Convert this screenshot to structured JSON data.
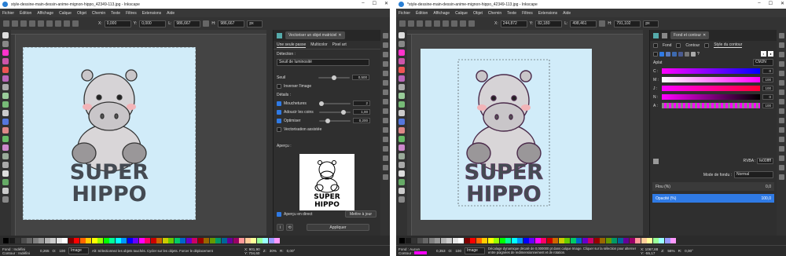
{
  "app": {
    "title": "style-dessine-main-dessin-anime-mignon-hippo_42349-113.jpg - Inkscape",
    "title2": "*style-dessine-main-dessin-anime-mignon-hippo_42349-113.jpg - Inkscape"
  },
  "menu": [
    "Fichier",
    "Édition",
    "Affichage",
    "Calque",
    "Objet",
    "Chemin",
    "Texte",
    "Filtres",
    "Extensions",
    "Aide"
  ],
  "w1": {
    "ctrl": {
      "x_label": "X:",
      "x": "0,000",
      "y_label": "Y:",
      "y": "0,000",
      "w_label": "L:",
      "w": "986,667",
      "h_label": "H:",
      "h": "986,667",
      "unit": "px"
    },
    "panel": {
      "title": "Vectoriser un objet matriciel",
      "tabs": [
        "Une seule passe",
        "Multicolor",
        "Pixel art"
      ],
      "detection": "Détection :",
      "mode": "Seuil de luminosité",
      "seuil": "Seuil",
      "seuil_val": "0,500",
      "inverser": "Inverser l'image",
      "details": "Détails :",
      "mouch": "Mouchetures",
      "mouch_val": "2",
      "adoucir": "Adoucir les coins",
      "adoucir_val": "1,00",
      "optim": "Optimiser",
      "optim_val": "0,200",
      "assist": "Vectorisation assistée",
      "apercu": "Aperçu :",
      "live": "Aperçu en direct",
      "update": "Mettre à jour",
      "apply": "Appliquer"
    },
    "status": {
      "fond": "Fond :",
      "contour": "Contour :",
      "fond_val": "Indéfini",
      "contour_val": "Indéfini",
      "contour_w": "0,265",
      "o": "O:",
      "opacity": "100",
      "layer": "Image",
      "msg": "Alt: Sélectionnez les objets touchés. Cycler sur les objets. Forcer le déplacement",
      "x": "X: 901,90",
      "y": "Y: 704,60",
      "z": "Z:",
      "zoom": "30%",
      "r": "R:",
      "rot": "0,00°"
    }
  },
  "w2": {
    "ctrl": {
      "x_label": "X:",
      "x": "244,872",
      "y_label": "Y:",
      "y": "82,180",
      "w_label": "L:",
      "w": "498,461",
      "h_label": "H:",
      "h": "791,102",
      "unit": "px"
    },
    "panel": {
      "title": "Fond et contour",
      "tabs": [
        "Fond",
        "Contour",
        "Style du contour"
      ],
      "aplat": "Aplat",
      "model": "CMJN",
      "channels": [
        {
          "n": "C :",
          "v": "0"
        },
        {
          "n": "M :",
          "v": "100"
        },
        {
          "n": "J :",
          "v": "100"
        },
        {
          "n": "N :",
          "v": "0"
        },
        {
          "n": "A :",
          "v": "100"
        }
      ],
      "rvba_label": "RVBA :",
      "rvba": "fe00ffff",
      "blend_label": "Mode de fondu :",
      "blend": "Normal",
      "flou": "Flou (%)",
      "flou_val": "0,0",
      "opac": "Opacité (%)",
      "opac_val": "100,0"
    },
    "status": {
      "fond": "Fond :",
      "contour": "Contour :",
      "fond_val": "Aucun",
      "contour_w": "0,353",
      "o": "O:",
      "opacity": "100",
      "layer": "Image",
      "msg": "Décalage dynamique décalé de 0,000000 pt dans calque Image. Cliquer sur la sélection pour alterner entre poignées de redimensionnement et de rotation.",
      "x": "X: 1067,88",
      "y": "Y: -55,17",
      "z": "Z:",
      "zoom": "56%",
      "r": "R:",
      "rot": "0,00°"
    }
  },
  "art": {
    "line1": "SUPER",
    "line2": "HIPPO"
  },
  "colors": {
    "accent": "#2f7ae5",
    "page": "#d1ecf9",
    "magenta": "#fe00ff"
  }
}
